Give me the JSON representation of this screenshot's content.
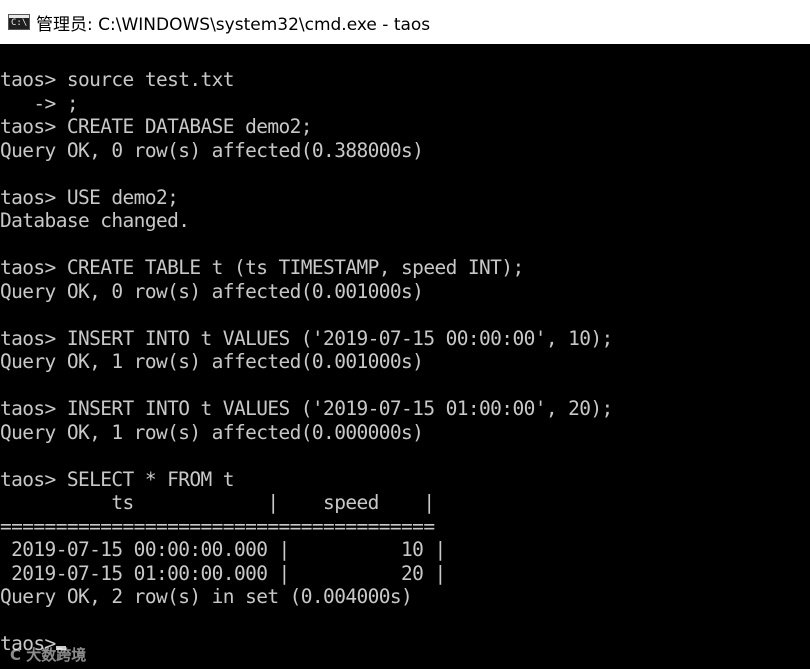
{
  "window": {
    "title": "管理员: C:\\WINDOWS\\system32\\cmd.exe - taos",
    "icon": "cmd-icon"
  },
  "console": {
    "lines": [
      "taos> source test.txt",
      "   -> ;",
      "taos> CREATE DATABASE demo2;",
      "Query OK, 0 row(s) affected(0.388000s)",
      "",
      "taos> USE demo2;",
      "Database changed.",
      "",
      "taos> CREATE TABLE t (ts TIMESTAMP, speed INT);",
      "Query OK, 0 row(s) affected(0.001000s)",
      "",
      "taos> INSERT INTO t VALUES ('2019-07-15 00:00:00', 10);",
      "Query OK, 1 row(s) affected(0.001000s)",
      "",
      "taos> INSERT INTO t VALUES ('2019-07-15 01:00:00', 20);",
      "Query OK, 1 row(s) affected(0.000000s)",
      "",
      "taos> SELECT * FROM t",
      "          ts            |    speed    |",
      "=======================================",
      " 2019-07-15 00:00:00.000 |          10 |",
      " 2019-07-15 01:00:00.000 |          20 |",
      "Query OK, 2 row(s) in set (0.004000s)",
      "",
      "taos>"
    ],
    "text_color": "#c8c8c8",
    "background": "#000000"
  },
  "watermark": "C 大数跨境"
}
